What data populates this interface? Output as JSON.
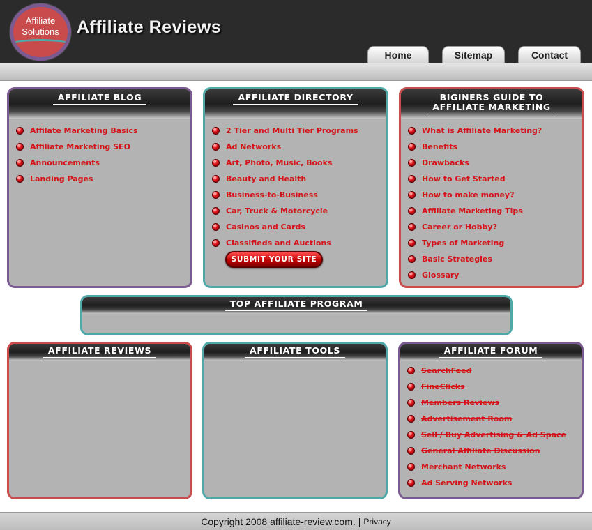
{
  "header": {
    "logo_line1": "Affiliate",
    "logo_line2": "Solutions",
    "title": "Affiliate Reviews",
    "nav": [
      "Home",
      "Sitemap",
      "Contact"
    ]
  },
  "colors": {
    "purple": "#7b5a91",
    "teal": "#4fa8a8",
    "red": "#c94b4b",
    "link": "#d4141a"
  },
  "panels": {
    "blog": {
      "title": "AFFILIATE BLOG",
      "items": [
        "Affilate Marketing Basics",
        "Affiliate Marketing SEO",
        "Announcements",
        "Landing Pages"
      ]
    },
    "directory": {
      "title": "AFFILIATE DIRECTORY",
      "items": [
        "2 Tier and Multi Tier Programs",
        "Ad Networks",
        "Art, Photo, Music, Books",
        "Beauty and Health",
        "Business-to-Business",
        "Car, Truck & Motorcycle",
        "Casinos and Cards",
        "Classifieds and Auctions"
      ],
      "submit_label": "SUBMIT YOUR SITE"
    },
    "guide": {
      "title_line1": "BIGINERS GUIDE TO",
      "title_line2": "AFFILIATE MARKETING",
      "items": [
        "What is Affiliate Marketing?",
        "Benefits",
        "Drawbacks",
        "How to Get Started",
        "How to make money?",
        "Affiliate Marketing Tips",
        "Career or Hobby?",
        "Types of Marketing",
        "Basic Strategies",
        "Glossary"
      ]
    },
    "top": {
      "title": "TOP AFFILIATE PROGRAM"
    },
    "reviews": {
      "title": "AFFILIATE REVIEWS"
    },
    "tools": {
      "title": "AFFILIATE TOOLS"
    },
    "forum": {
      "title": "AFFILIATE FORUM",
      "items": [
        "SearchFeed",
        "FineClicks",
        "Members Reviews",
        "Advertisement Room",
        "Sell / Buy Advertising & Ad Space",
        "General Affiliate Discussion",
        "Merchant Networks",
        "Ad Serving Networks"
      ]
    }
  },
  "footer": {
    "copyright": "Copyright 2008 affiliate-review.com.",
    "separator": "|",
    "privacy": "Privacy"
  }
}
